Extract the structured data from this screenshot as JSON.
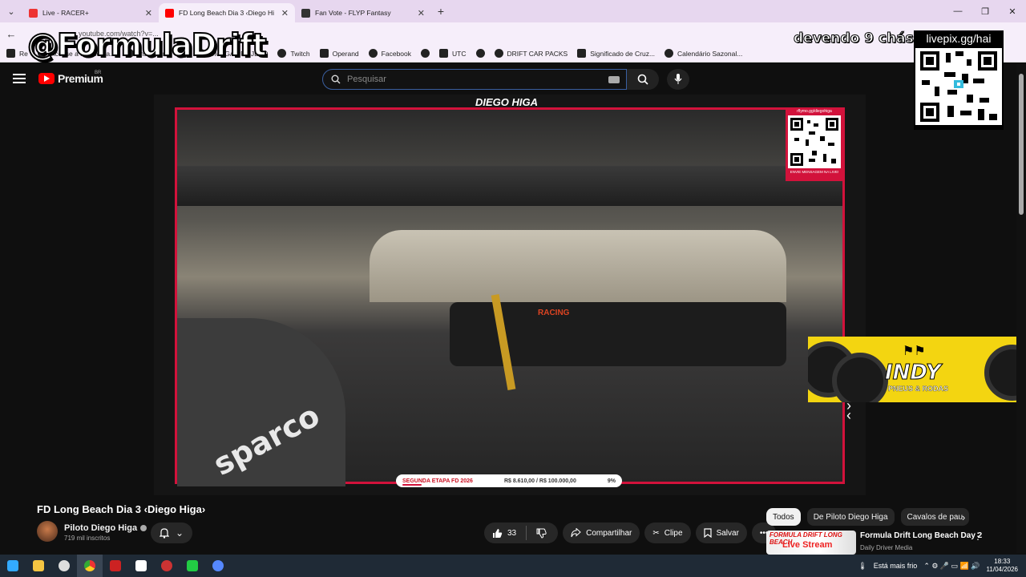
{
  "browser": {
    "tabs": [
      {
        "label": "Live - RACER+",
        "icon_color": "#e33"
      },
      {
        "label": "FD Long Beach Dia 3 ‹Diego Hi",
        "icon_color": "#f00",
        "active": true
      },
      {
        "label": "Fan Vote - FLYP Fantasy",
        "icon_color": "#333"
      }
    ],
    "url": "youtube.com/watch?v=...",
    "bookmarks": [
      {
        "label": "Re"
      },
      {
        "label": "Acesse a sua conta..."
      },
      {
        "label": "Instagram"
      },
      {
        "label": ""
      },
      {
        "label": "OMEGA PROJETO"
      },
      {
        "label": "Twitch"
      },
      {
        "label": "Operand"
      },
      {
        "label": "Facebook"
      },
      {
        "label": ""
      },
      {
        "label": "UTC"
      },
      {
        "label": ""
      },
      {
        "label": "DRIFT CAR PACKS"
      },
      {
        "label": "Significado de Cruz..."
      },
      {
        "label": "Calendário Sazonal..."
      }
    ]
  },
  "youtube": {
    "logo_text": "Premium",
    "region": "BR",
    "search_placeholder": "Pesquisar"
  },
  "overlay": {
    "handle": "@FormulaDrift",
    "debt_text": "devendo 9 chás",
    "livepix_url": "livepix.gg/hai",
    "sponsor_brand": "INDY",
    "sponsor_sub": "PNEUS & RODAS"
  },
  "video_frame": {
    "driver_plate": "DIEGO HIGA",
    "qr_label": "rflymo.gg/diegohiga",
    "qr_footer": "ENVIE MENSAGEM NA LIVE!",
    "progress_stage": "SEGUNDA ETAPA FD 2026",
    "progress_amount": "R$ 8.610,00 / R$ 100.000,00",
    "progress_pct": "9%",
    "progress_value": 0.09,
    "dash_badge": "RACING",
    "glove_brand": "sparco"
  },
  "video": {
    "title": "FD Long Beach Dia 3 ‹Diego Higa›",
    "channel": "Piloto Diego Higa",
    "subscribers": "719 mil inscritos",
    "likes": "33",
    "share": "Compartilhar",
    "clip": "Clipe",
    "save": "Salvar"
  },
  "sidebar": {
    "chips": [
      "Todos",
      "De Piloto Diego Higa",
      "Cavalos de pau"
    ],
    "recommendation": {
      "title": "Formula Drift Long Beach Day 2",
      "channel": "Daily Driver Media",
      "thumb_top": "FORMULA DRIFT LONG BEACH",
      "thumb_text": "Live Stream"
    }
  },
  "taskbar": {
    "weather": "Está mais frio",
    "time": "18:33",
    "date": "11/04/2026",
    "icons": [
      "windows-icon",
      "file-explorer-icon",
      "settings-icon",
      "chrome-icon",
      "ms-icon",
      "app-icon",
      "app2-icon",
      "play-icon",
      "discord-icon"
    ]
  }
}
